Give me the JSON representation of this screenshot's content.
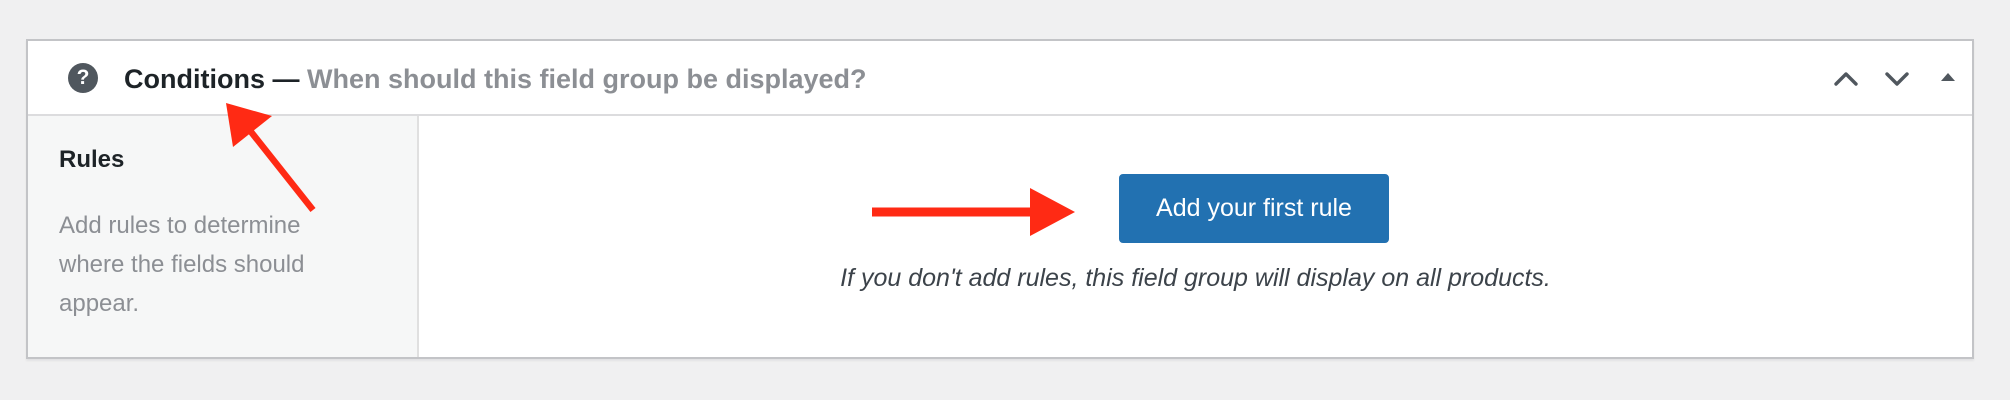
{
  "panel": {
    "title": "Conditions",
    "separator": " — ",
    "subtitle": "When should this field group be displayed?",
    "help_icon": "question-circle-icon",
    "controls": {
      "move_up_icon": "chevron-up-icon",
      "move_down_icon": "chevron-down-icon",
      "toggle_icon": "triangle-up-icon"
    }
  },
  "sidebar": {
    "heading": "Rules",
    "description": "Add rules to determine where the fields should appear."
  },
  "main": {
    "add_rule_label": "Add your first rule",
    "note": "If you don't add rules, this field group will display on all products."
  },
  "annotations": {
    "arrow_color": "#ff2a14"
  },
  "colors": {
    "button_bg": "#2271b1",
    "sidebar_bg": "#f6f7f7",
    "page_bg": "#f0f0f1"
  }
}
